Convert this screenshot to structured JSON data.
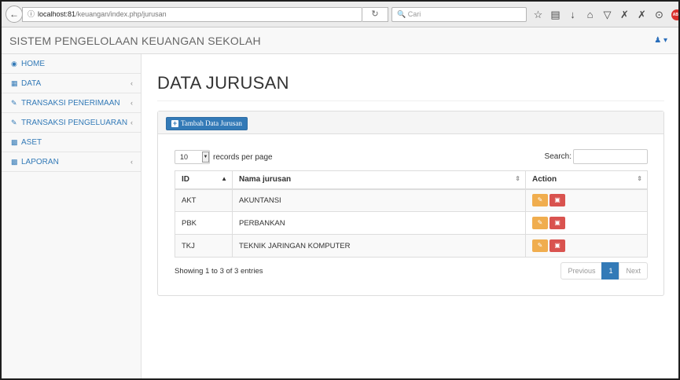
{
  "browser": {
    "url_host": "localhost:81",
    "url_path": "/keuangan/index.php/jurusan",
    "search_placeholder": "Cari"
  },
  "app": {
    "brand": "SISTEM PENGELOLAAN KEUANGAN SEKOLAH"
  },
  "sidebar": {
    "items": [
      {
        "label": "HOME",
        "icon": "dashboard-icon",
        "has_submenu": false
      },
      {
        "label": "DATA",
        "icon": "table-icon",
        "has_submenu": true
      },
      {
        "label": "TRANSAKSI PENERIMAAN",
        "icon": "edit-icon",
        "has_submenu": true
      },
      {
        "label": "TRANSAKSI PENGELUARAN",
        "icon": "edit-icon",
        "has_submenu": true
      },
      {
        "label": "ASET",
        "icon": "book-icon",
        "has_submenu": false
      },
      {
        "label": "LAPORAN",
        "icon": "book-icon",
        "has_submenu": true
      }
    ]
  },
  "page": {
    "title": "DATA JURUSAN",
    "add_button_label": "Tambah Data Jurusan"
  },
  "table": {
    "length_value": "10",
    "length_suffix": "records per page",
    "search_label": "Search:",
    "headers": [
      "ID",
      "Nama jurusan",
      "Action"
    ],
    "rows": [
      {
        "id": "AKT",
        "nama": "AKUNTANSI"
      },
      {
        "id": "PBK",
        "nama": "PERBANKAN"
      },
      {
        "id": "TKJ",
        "nama": "TEKNIK JARINGAN KOMPUTER"
      }
    ],
    "info": "Showing 1 to 3 of 3 entries",
    "pagination": {
      "previous": "Previous",
      "current": "1",
      "next": "Next"
    }
  },
  "colors": {
    "primary": "#337ab7",
    "edit": "#f0ad4e",
    "delete": "#d9534f"
  }
}
